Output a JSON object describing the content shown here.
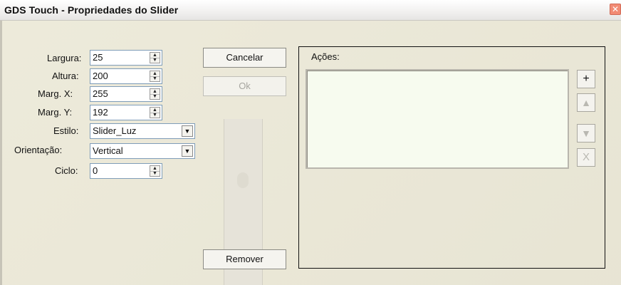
{
  "window": {
    "title": "GDS Touch - Propriedades do Slider",
    "close_glyph": "✕"
  },
  "form": {
    "largura": {
      "label": "Largura:",
      "value": "25"
    },
    "altura": {
      "label": "Altura:",
      "value": "200"
    },
    "marg_x": {
      "label": "Marg. X:",
      "value": "255"
    },
    "marg_y": {
      "label": "Marg. Y:",
      "value": "192"
    },
    "estilo": {
      "label": "Estilo:",
      "value": "Slider_Luz"
    },
    "orientacao": {
      "label": "Orientação:",
      "value": "Vertical"
    },
    "ciclo": {
      "label": "Ciclo:",
      "value": "0"
    }
  },
  "buttons": {
    "cancelar": "Cancelar",
    "ok": "Ok",
    "remover": "Remover"
  },
  "acoes": {
    "label": "Ações:",
    "side_buttons": {
      "add": "+",
      "up": "▲",
      "down": "▼",
      "delete": "X"
    }
  },
  "icons": {
    "spin_up": "▲",
    "spin_down": "▼",
    "dropdown": "▼"
  }
}
